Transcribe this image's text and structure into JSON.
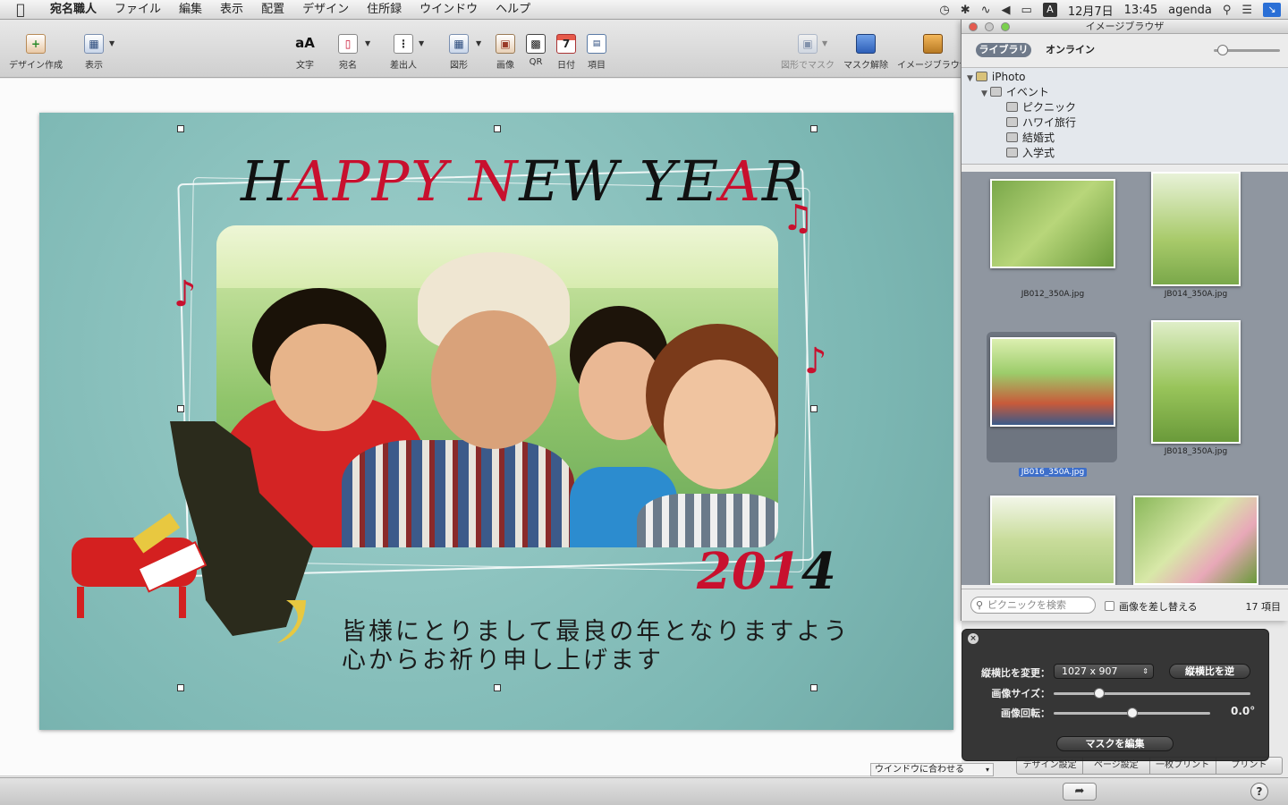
{
  "menubar": {
    "app_name": "宛名職人",
    "items": [
      "ファイル",
      "編集",
      "表示",
      "配置",
      "デザイン",
      "住所録",
      "ウインドウ",
      "ヘルプ"
    ],
    "date": "12月7日",
    "time": "13:45",
    "user": "agenda",
    "input_mode": "A"
  },
  "toolbar": {
    "design": "デザイン作成",
    "view": "表示",
    "text": "文字",
    "address": "宛名",
    "sender": "差出人",
    "shape": "図形",
    "image": "画像",
    "qr": "QR",
    "date": "日付",
    "item": "項目",
    "mask_shape": "図形でマスク",
    "mask_release": "マスク解除",
    "image_browser": "イメージブラウザ"
  },
  "card": {
    "title_part1": "H",
    "title_part2": "APP",
    "title_part3": "Y",
    "title_part4": " N",
    "title_part5": "E",
    "title_part6": "W ",
    "title_part7": " YE",
    "title_part8": "A",
    "title_part9": "R",
    "year_1": "201",
    "year_2": "4",
    "message_line1": "皆様にとりまして最良の年となりますよう",
    "message_line2": "心からお祈り申し上げます"
  },
  "canvas": {
    "zoom_label": "ウインドウに合わせる"
  },
  "bottom_tabs": [
    "デザイン設定",
    "ページ設定",
    "一枚プリント",
    "プリント"
  ],
  "image_browser": {
    "title": "イメージブラウザ",
    "tab_library": "ライブラリ",
    "tab_online": "オンライン",
    "tree": {
      "root": "iPhoto",
      "events": "イベント",
      "albums": [
        "ピクニック",
        "ハワイ旅行",
        "結婚式",
        "入学式"
      ]
    },
    "thumbnails": [
      {
        "name": "JB012_350A.jpg"
      },
      {
        "name": "JB014_350A.jpg"
      },
      {
        "name": "JB016_350A.jpg",
        "selected": true
      },
      {
        "name": "JB018_350A.jpg"
      },
      {
        "name": ""
      },
      {
        "name": ""
      }
    ],
    "search_placeholder": "ピクニックを検索",
    "replace_label": "画像を差し替える",
    "count": "17 項目"
  },
  "hud": {
    "aspect_label": "縦横比を変更：",
    "aspect_value": "1027 x 907",
    "reverse_button": "縦横比を逆",
    "size_label": "画像サイズ：",
    "size_slider_level": 0.23,
    "rotation_label": "画像回転：",
    "rotation_slider_level": 0.5,
    "rotation_value": "0.0°",
    "edit_mask_button": "マスクを編集"
  },
  "colors": {
    "card_red": "#c8102e",
    "card_bg": "#8ec4c1",
    "selection_blue": "#3d6ec9",
    "grid_bg": "#8f96a0"
  }
}
